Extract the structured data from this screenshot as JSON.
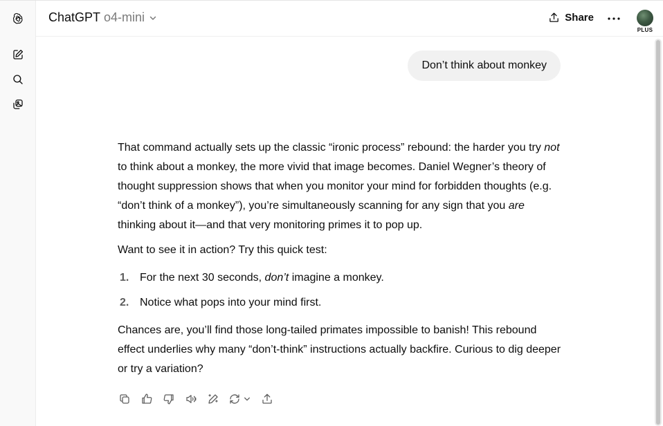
{
  "header": {
    "brand": "ChatGPT",
    "model": "o4-mini",
    "share_label": "Share",
    "plan_badge": "PLUS"
  },
  "rail": {
    "icons": [
      "openai-logo-icon",
      "new-chat-icon",
      "search-icon",
      "library-icon"
    ]
  },
  "conversation": {
    "user_message": "Don’t think about monkey",
    "reply": {
      "p1_a": "That command actually sets up the classic “ironic process” rebound: the harder you try ",
      "p1_em1": "not",
      "p1_b": " to think about a monkey, the more vivid that image becomes. Daniel Wegner’s theory of thought suppression shows that when you monitor your mind for forbidden thoughts (e.g. “don’t think of a monkey”), you’re simultaneously scanning for any sign that you ",
      "p1_em2": "are",
      "p1_c": " thinking about it—and that very monitoring primes it to pop up.",
      "p2": "Want to see it in action? Try this quick test:",
      "list": [
        {
          "num": "1.",
          "a": "For the next 30 seconds, ",
          "em": "don’t",
          "b": " imagine a monkey."
        },
        {
          "num": "2.",
          "a": "Notice what pops into your mind first.",
          "em": "",
          "b": ""
        }
      ],
      "p3": "Chances are, you’ll find those long-tailed primates impossible to banish! This rebound effect underlies why many “don’t-think” instructions actually backfire. Curious to dig deeper or try a variation?"
    },
    "actions": [
      "copy-icon",
      "thumbs-up-icon",
      "thumbs-down-icon",
      "read-aloud-icon",
      "edit-canvas-icon",
      "regenerate-icon",
      "share-icon"
    ]
  },
  "colors": {
    "bubble_bg": "#f1f1f1",
    "rail_bg": "#f9f9f9",
    "text": "#0d0d0d",
    "muted": "#7a7a7a"
  }
}
